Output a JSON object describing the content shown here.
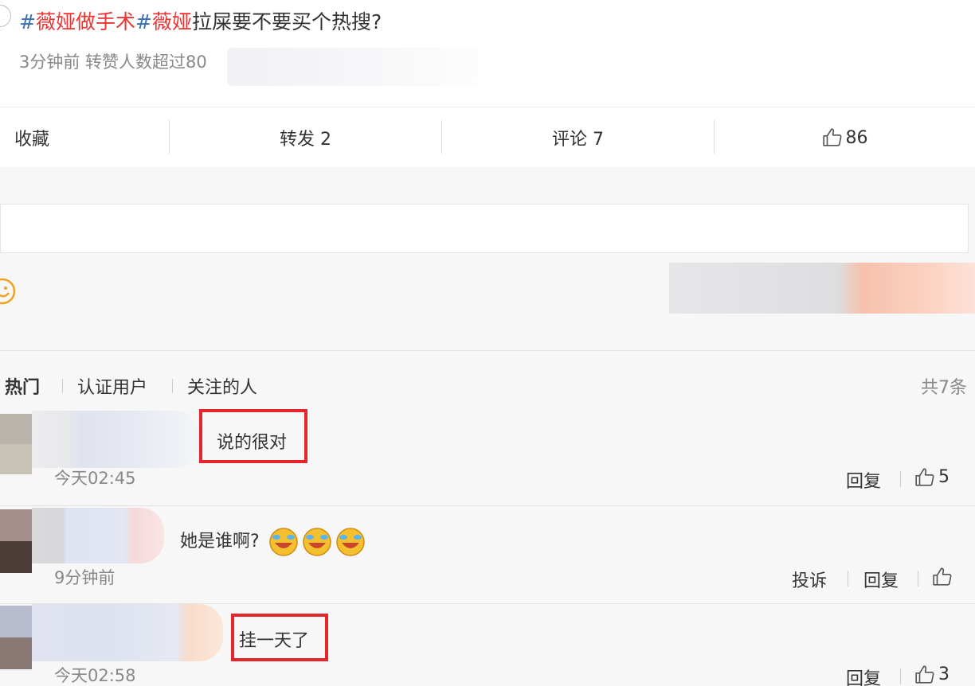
{
  "post": {
    "tag1": "薇娅做手术",
    "tag2": "薇娅",
    "text": "拉屎要不要买个热搜?",
    "hash": "#",
    "meta": "3分钟前 转赞人数超过80"
  },
  "actions": {
    "favorite": "收藏",
    "forward": "转发 2",
    "comment": "评论 7",
    "like_count": "86"
  },
  "comment_filters": {
    "hot": "热门",
    "verified": "认证用户",
    "following": "关注的人",
    "total": "共7条"
  },
  "comments": [
    {
      "text": "说的很对",
      "time": "今天02:45",
      "reply": "回复",
      "likes": "5"
    },
    {
      "text": "她是谁啊?",
      "time": "9分钟前",
      "report": "投诉",
      "reply": "回复",
      "emoji_count": 3
    },
    {
      "text": "挂一天了",
      "time": "今天02:58",
      "reply": "回复",
      "likes": "3"
    }
  ],
  "colors": {
    "highlight_box": "#e4252b",
    "hashtag": "#e33333"
  }
}
